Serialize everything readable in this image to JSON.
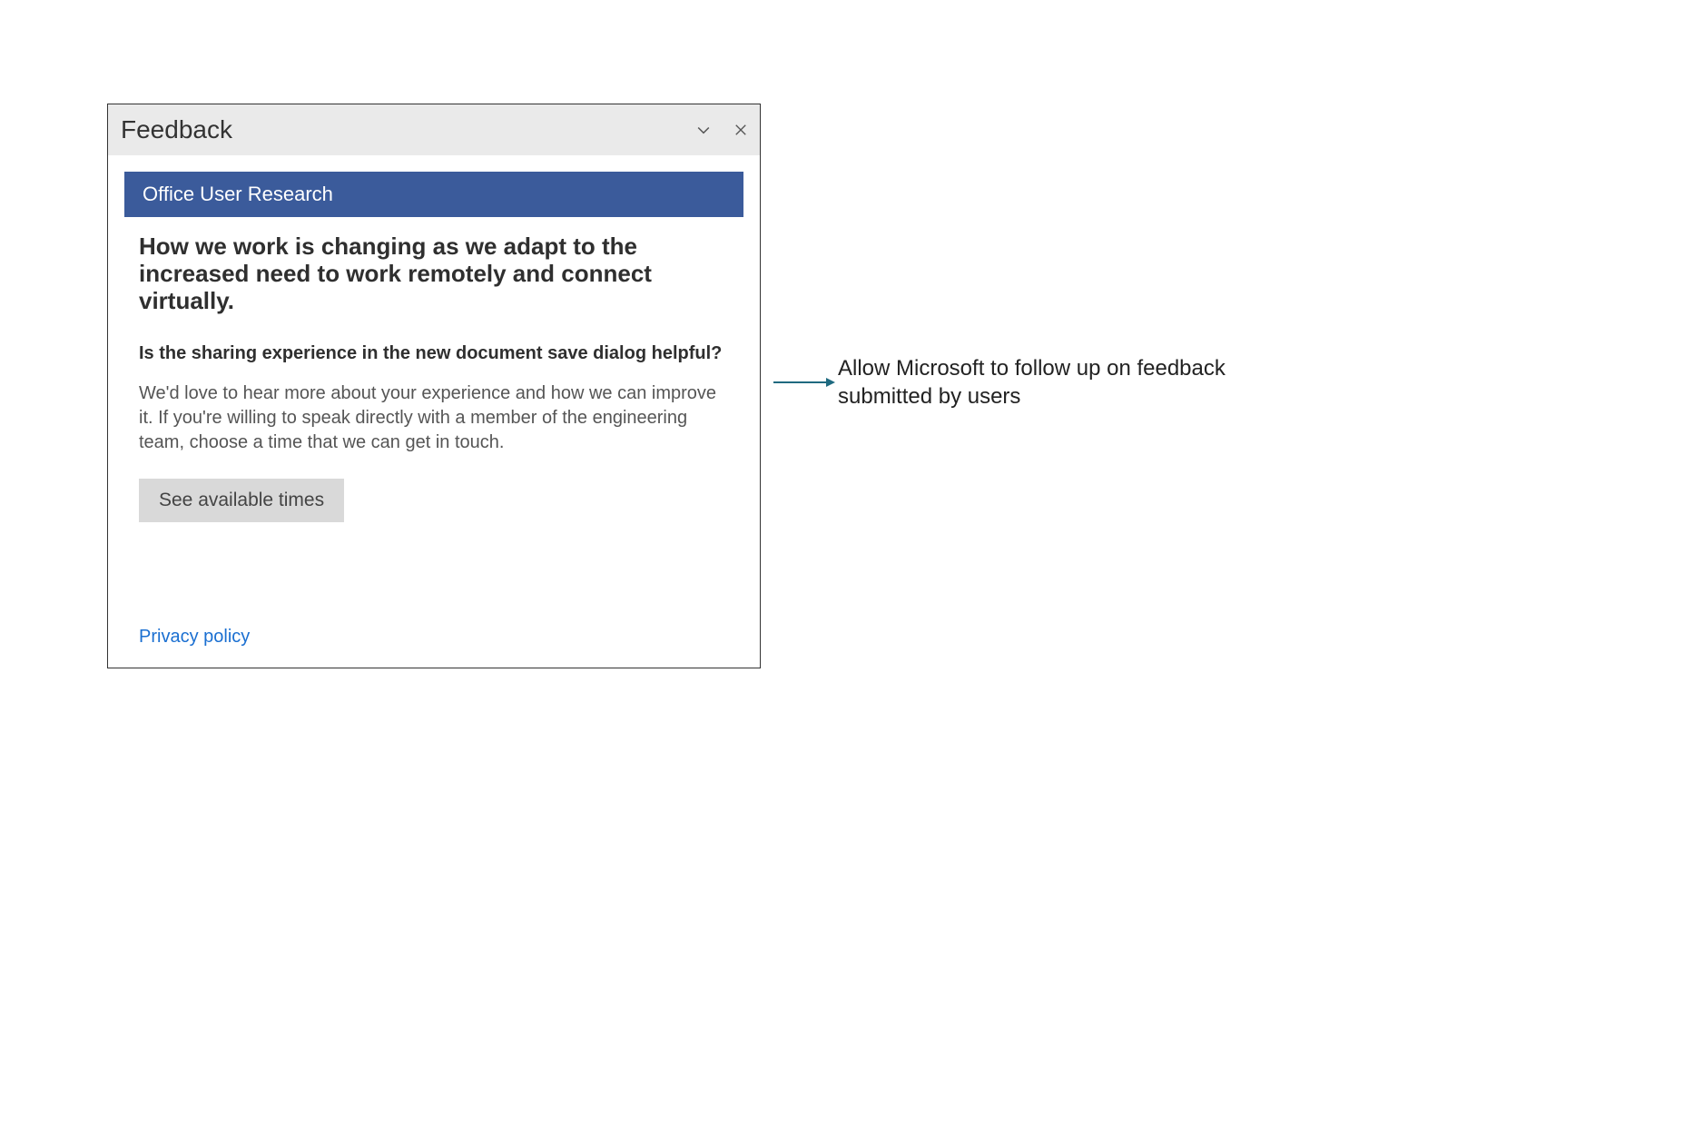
{
  "dialog": {
    "title": "Feedback",
    "banner": "Office User Research",
    "heading": "How we work is changing as we adapt to the increased need to work remotely and connect virtually.",
    "subheading": "Is the sharing experience in the new document save dialog helpful?",
    "body": "We'd love to hear more about your experience and how we can improve it. If you're willing to speak directly with a member of the engineering team, choose a time that we can get in touch.",
    "action_label": "See available times",
    "privacy_link": "Privacy policy"
  },
  "annotation": {
    "text": "Allow Microsoft to follow up on feedback submitted by users"
  },
  "colors": {
    "banner_bg": "#3b5b9b",
    "link": "#1a6fd1",
    "arrow": "#1f6a80"
  }
}
